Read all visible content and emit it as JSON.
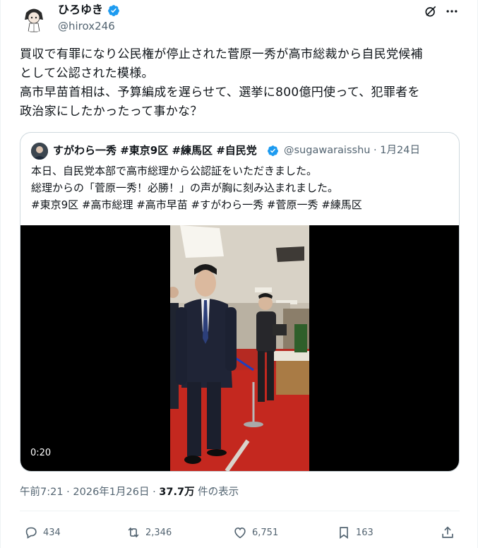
{
  "author": {
    "name": "ひろゆき",
    "handle": "@hirox246"
  },
  "post": {
    "lines": [
      "買収で有罪になり公民権が停止された菅原一秀が高市総裁から自民党候補",
      "として公認された模様。",
      "高市早苗首相は、予算編成を遅らせて、選挙に800億円使って、犯罪者を",
      "政治家にしたかったって事かな？"
    ]
  },
  "quote": {
    "name": "すがわら一秀 #東京9区 #練馬区 #自民党",
    "handle_date": "@sugawaraisshu · 1月24日",
    "lines": [
      "本日、自民党本部で高市総理から公認証をいただきました。",
      "総理からの「菅原一秀！必勝！」の声が胸に刻み込まれました。",
      "#東京9区 #高市総理 #高市早苗  #すがわら一秀 #菅原一秀 #練馬区"
    ],
    "video_duration": "0:20"
  },
  "meta": {
    "time_date": "午前7:21 · 2026年1月26日 · ",
    "views": "37.7万",
    "views_label": " 件の表示"
  },
  "actions": {
    "replies": "434",
    "reposts": "2,346",
    "likes": "6,751",
    "bookmarks": "163"
  },
  "icons": {
    "verified": "verified-badge-icon",
    "grok": "grok-icon",
    "more": "more-icon",
    "reply": "reply-icon",
    "repost": "repost-icon",
    "like": "like-icon",
    "bookmark": "bookmark-icon",
    "share": "share-icon"
  },
  "colors": {
    "verified_blue": "#1d9bf0",
    "secondary_text": "#536471",
    "border": "#cfd9de"
  }
}
